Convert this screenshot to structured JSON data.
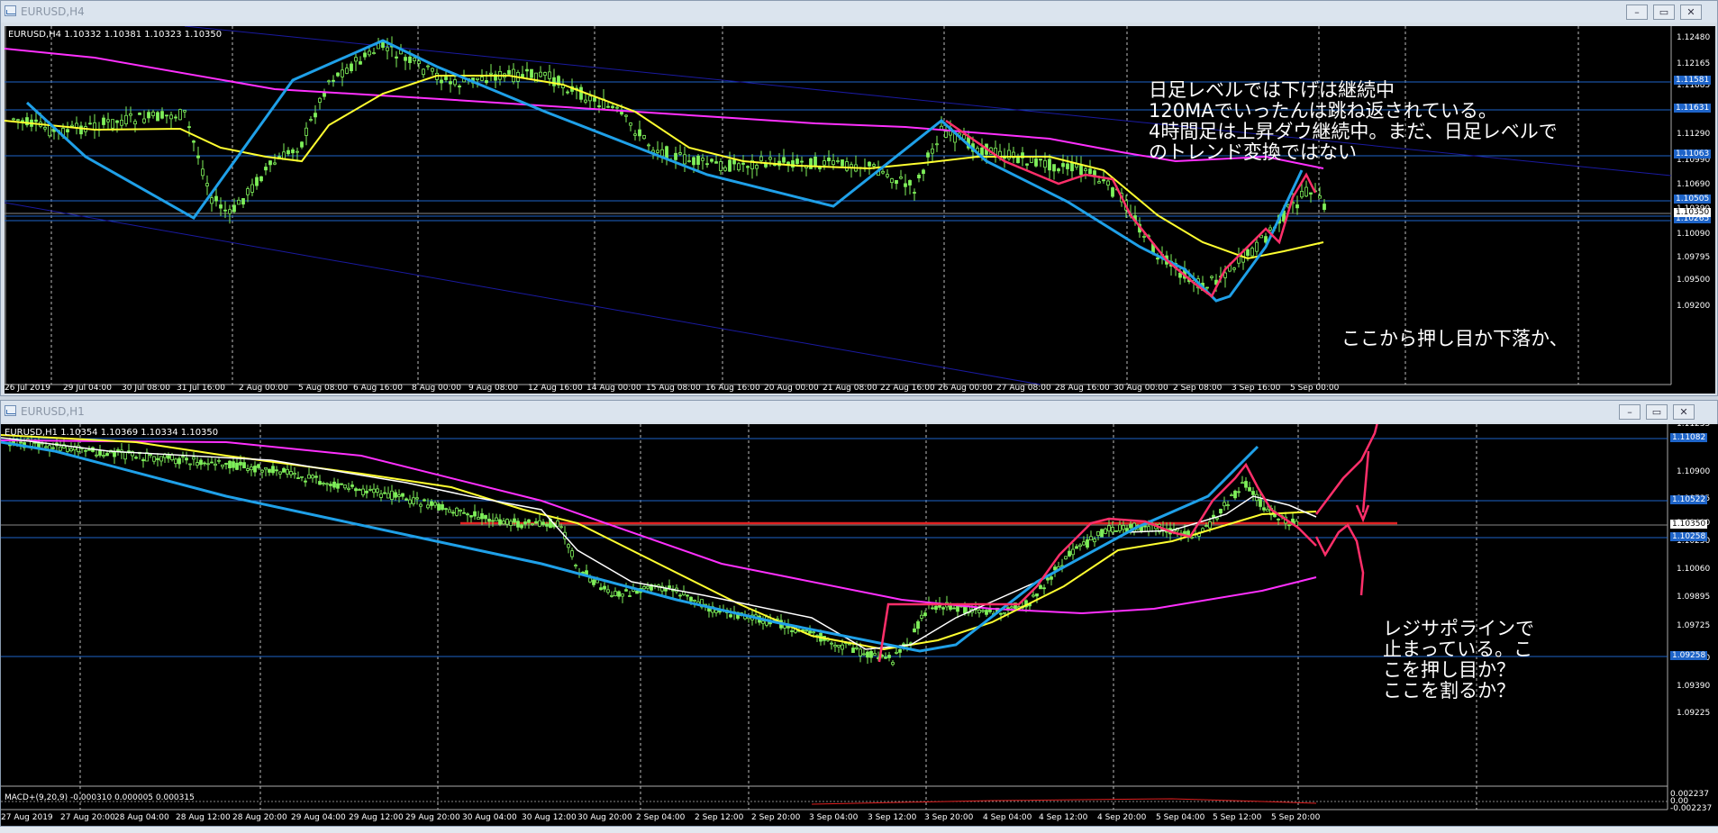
{
  "window_top": {
    "title": "EURUSD,H4",
    "symbol_line": "EURUSD,H4  1.10332 1.10381 1.10323 1.10350"
  },
  "window_bottom": {
    "title": "EURUSD,H1",
    "symbol_line": "EURUSD,H1  1.10354 1.10369 1.10334 1.10350",
    "macd_line": "MACD+(9,20,9) -0.000310 0.000005 0.000315"
  },
  "window_buttons": {
    "minimize": "–",
    "restore": "▭",
    "close": "✕"
  },
  "annotations": {
    "top_main": [
      "日足レベルでは下げは継続中",
      "120MAでいったんは跳ね返されている。",
      "4時間足は上昇ダウ継続中。まだ、日足レベルで",
      "のトレンド変換ではない"
    ],
    "top_question": "ここから押し目か下落か、",
    "bottom_main": [
      "レジサポラインで",
      "止まっている。こ",
      "こを押し目か？",
      "ここを割るか？"
    ]
  },
  "top_price_labels": [
    "1.12480",
    "1.12165",
    "1.11885",
    "1.11570",
    "1.11290",
    "1.10990",
    "1.10690",
    "1.10390",
    "1.10090",
    "1.09795",
    "1.09500",
    "1.09200"
  ],
  "top_level_boxes": [
    "1.11581",
    "1.11631",
    "1.11063",
    "1.10505",
    "1.10265"
  ],
  "top_current_price": "1.10350",
  "top_time_labels": [
    "26 Jul 2019",
    "29 Jul 04:00",
    "30 Jul 08:00",
    "31 Jul 16:00",
    "2 Aug 00:00",
    "5 Aug 08:00",
    "6 Aug 16:00",
    "8 Aug 00:00",
    "9 Aug 08:00",
    "12 Aug 16:00",
    "14 Aug 00:00",
    "15 Aug 08:00",
    "16 Aug 16:00",
    "20 Aug 00:00",
    "21 Aug 08:00",
    "22 Aug 16:00",
    "26 Aug 00:00",
    "27 Aug 08:00",
    "28 Aug 16:00",
    "30 Aug 00:00",
    "2 Sep 08:00",
    "3 Sep 16:00",
    "5 Sep 00:00"
  ],
  "bottom_price_labels": [
    "1.11235",
    "1.10900",
    "1.10735",
    "1.10400",
    "1.10230",
    "1.10060",
    "1.09895",
    "1.09725",
    "1.09560",
    "1.09390",
    "1.09225"
  ],
  "bottom_level_boxes": [
    "1.11082",
    "1.10522",
    "1.10258",
    "1.09258"
  ],
  "bottom_current_price": "1.10350",
  "macd_labels": [
    "0.002237",
    "0.00",
    "-0.002237"
  ],
  "bottom_time_labels": [
    "27 Aug 2019",
    "27 Aug 20:00",
    "28 Aug 04:00",
    "28 Aug 12:00",
    "28 Aug 20:00",
    "29 Aug 04:00",
    "29 Aug 12:00",
    "29 Aug 20:00",
    "30 Aug 04:00",
    "30 Aug 12:00",
    "30 Aug 20:00",
    "2 Sep 04:00",
    "2 Sep 12:00",
    "2 Sep 20:00",
    "3 Sep 04:00",
    "3 Sep 12:00",
    "3 Sep 20:00",
    "4 Sep 04:00",
    "4 Sep 12:00",
    "4 Sep 20:00",
    "5 Sep 04:00",
    "5 Sep 12:00",
    "5 Sep 20:00"
  ],
  "colors": {
    "background": "#000000",
    "candle": "#7ff05a",
    "ma_fast": "#ffffff",
    "ma_mid": "#ffff30",
    "ma_slow": "#ff30ff",
    "trend_blue": "#1fa0e8",
    "annotation_red": "#ff2f6a",
    "support_line": "#e02020",
    "channel": "#1a1aa0",
    "level_line": "#1e64c8"
  }
}
